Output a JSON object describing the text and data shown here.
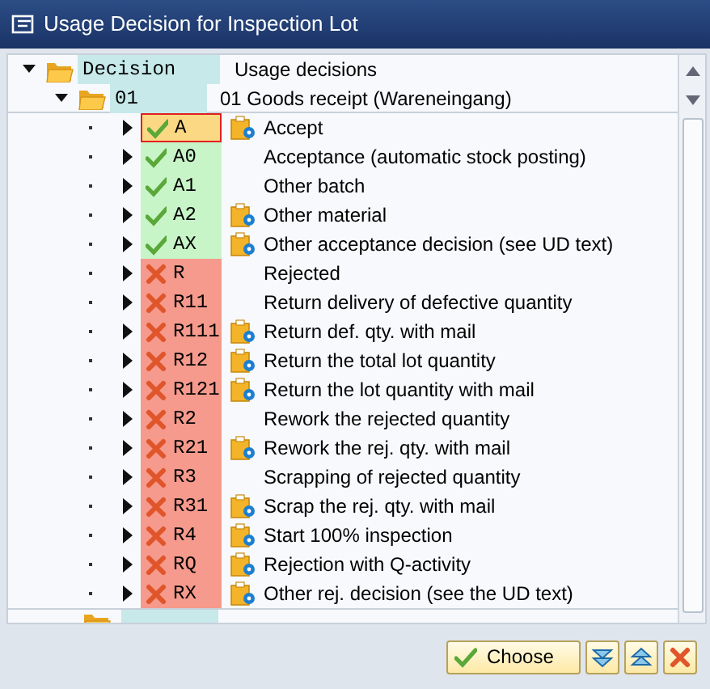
{
  "window": {
    "title": "Usage Decision for Inspection Lot"
  },
  "tree": {
    "header": {
      "expanded": true,
      "decision": "Decision",
      "usage_decisions": "Usage decisions"
    },
    "group": {
      "expanded": true,
      "code": "01",
      "text": "01 Goods receipt (Wareneingang)"
    },
    "items": [
      {
        "kind": "accept",
        "code": "A",
        "text": "Accept",
        "has_icon": true,
        "selected": true
      },
      {
        "kind": "accept",
        "code": "A0",
        "text": "Acceptance (automatic stock posting)",
        "has_icon": false,
        "selected": false
      },
      {
        "kind": "accept",
        "code": "A1",
        "text": "Other batch",
        "has_icon": false,
        "selected": false
      },
      {
        "kind": "accept",
        "code": "A2",
        "text": "Other material",
        "has_icon": true,
        "selected": false
      },
      {
        "kind": "accept",
        "code": "AX",
        "text": "Other acceptance decision (see UD text)",
        "has_icon": true,
        "selected": false
      },
      {
        "kind": "reject",
        "code": "R",
        "text": "Rejected",
        "has_icon": false,
        "selected": false
      },
      {
        "kind": "reject",
        "code": "R11",
        "text": "Return delivery of defective quantity",
        "has_icon": false,
        "selected": false
      },
      {
        "kind": "reject",
        "code": "R111",
        "text": "Return def. qty. with mail",
        "has_icon": true,
        "selected": false
      },
      {
        "kind": "reject",
        "code": "R12",
        "text": "Return the total lot quantity",
        "has_icon": true,
        "selected": false
      },
      {
        "kind": "reject",
        "code": "R121",
        "text": "Return the lot quantity with mail",
        "has_icon": true,
        "selected": false
      },
      {
        "kind": "reject",
        "code": "R2",
        "text": "Rework the rejected quantity",
        "has_icon": false,
        "selected": false
      },
      {
        "kind": "reject",
        "code": "R21",
        "text": "Rework the rej. qty. with mail",
        "has_icon": true,
        "selected": false
      },
      {
        "kind": "reject",
        "code": "R3",
        "text": "Scrapping of rejected quantity",
        "has_icon": false,
        "selected": false
      },
      {
        "kind": "reject",
        "code": "R31",
        "text": "Scrap the rej. qty. with mail",
        "has_icon": true,
        "selected": false
      },
      {
        "kind": "reject",
        "code": "R4",
        "text": "Start 100% inspection",
        "has_icon": true,
        "selected": false
      },
      {
        "kind": "reject",
        "code": "RQ",
        "text": "Rejection with Q-activity",
        "has_icon": true,
        "selected": false
      },
      {
        "kind": "reject",
        "code": "RX",
        "text": "Other rej. decision (see the UD text)",
        "has_icon": true,
        "selected": false
      }
    ]
  },
  "buttons": {
    "choose": "Choose"
  }
}
